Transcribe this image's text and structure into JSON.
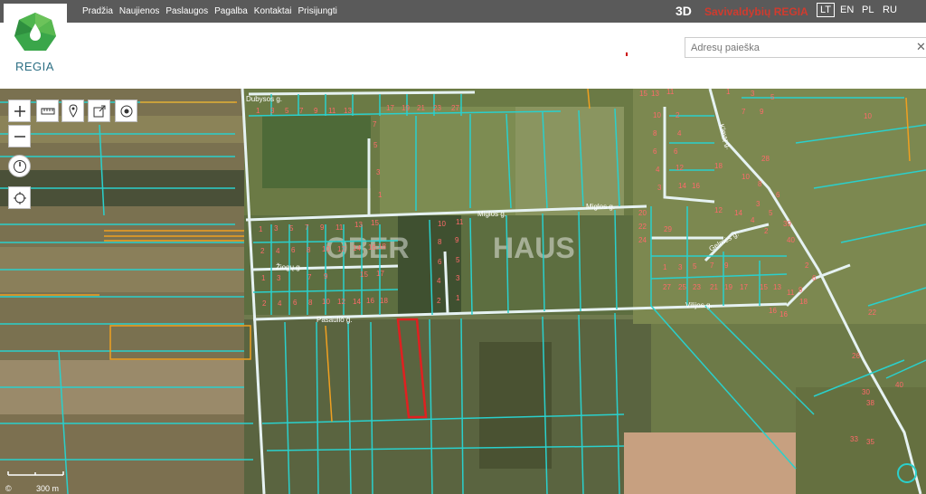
{
  "nav": {
    "items": [
      "Pradžia",
      "Naujienos",
      "Paslaugos",
      "Pagalba",
      "Kontaktai",
      "Prisijungti"
    ]
  },
  "logo": {
    "text": "REGIA"
  },
  "header_right": {
    "three_d": "3D",
    "brand": "Savivaldybių REGIA",
    "languages": [
      "LT",
      "EN",
      "PL",
      "RU"
    ],
    "active_language": "LT"
  },
  "search": {
    "placeholder": "Adresų paieška",
    "value": ""
  },
  "map": {
    "street_labels": [
      "Dubysos g.",
      "Miglos g.",
      "Miglos g.",
      "Žiogų g.",
      "Pasaulio g.",
      "Vilijos g.",
      "Klevų g.",
      "Gelmės g."
    ],
    "watermark": "OBER HAUS",
    "scale": "300 m",
    "colors": {
      "parcel": "#2ad0cc",
      "selected": "#e02020",
      "road": "#e8f4f4",
      "accent_orange": "#f0a020"
    }
  },
  "controls": {
    "zoom_in": "+",
    "zoom_out": "—"
  }
}
